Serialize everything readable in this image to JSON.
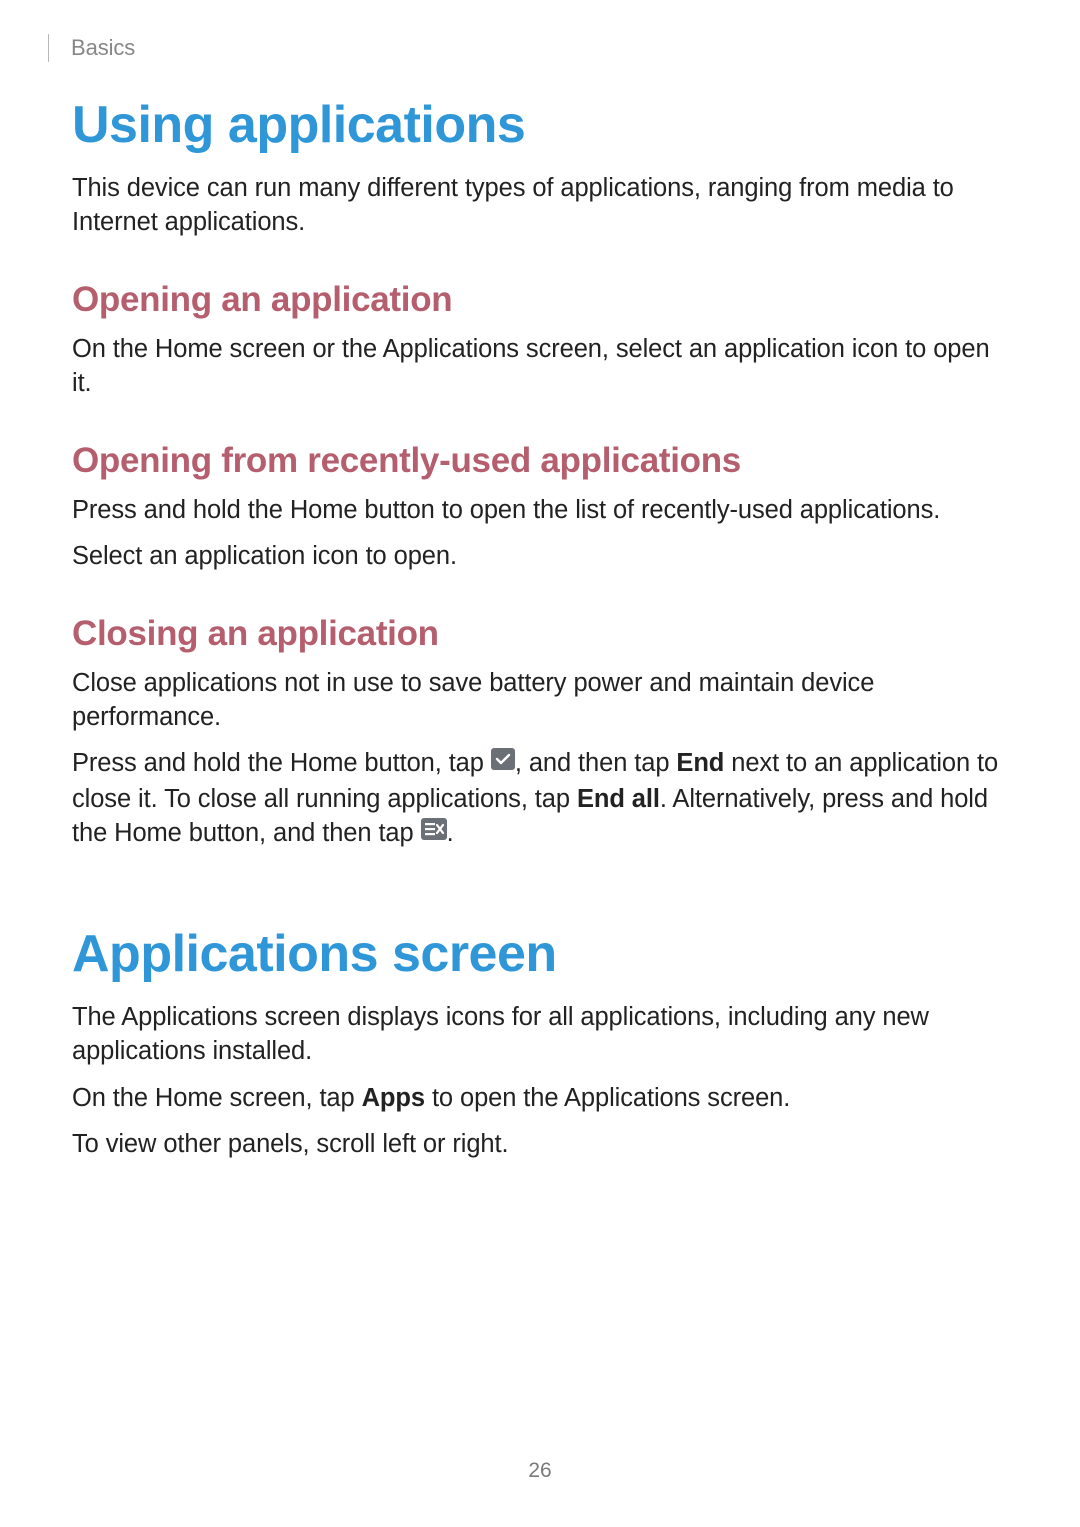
{
  "header": {
    "section": "Basics"
  },
  "page_number": "26",
  "section1": {
    "title": "Using applications",
    "intro": "This device can run many different types of applications, ranging from media to Internet applications.",
    "sub1": {
      "title": "Opening an application",
      "p1": "On the Home screen or the Applications screen, select an application icon to open it."
    },
    "sub2": {
      "title": "Opening from recently-used applications",
      "p1": "Press and hold the Home button to open the list of recently-used applications.",
      "p2": "Select an application icon to open."
    },
    "sub3": {
      "title": "Closing an application",
      "p1": "Close applications not in use to save battery power and maintain device performance.",
      "p2a": "Press and hold the Home button, tap ",
      "p2b": ", and then tap ",
      "p2c": " next to an application to close it. To close all running applications, tap ",
      "p2d": ". Alternatively, press and hold the Home button, and then tap ",
      "p2e": ".",
      "bold_end": "End",
      "bold_endall": "End all"
    }
  },
  "section2": {
    "title": "Applications screen",
    "p1": "The Applications screen displays icons for all applications, including any new applications installed.",
    "p2a": "On the Home screen, tap ",
    "p2b": " to open the Applications screen.",
    "bold_apps": "Apps",
    "p3": "To view other panels, scroll left or right."
  }
}
